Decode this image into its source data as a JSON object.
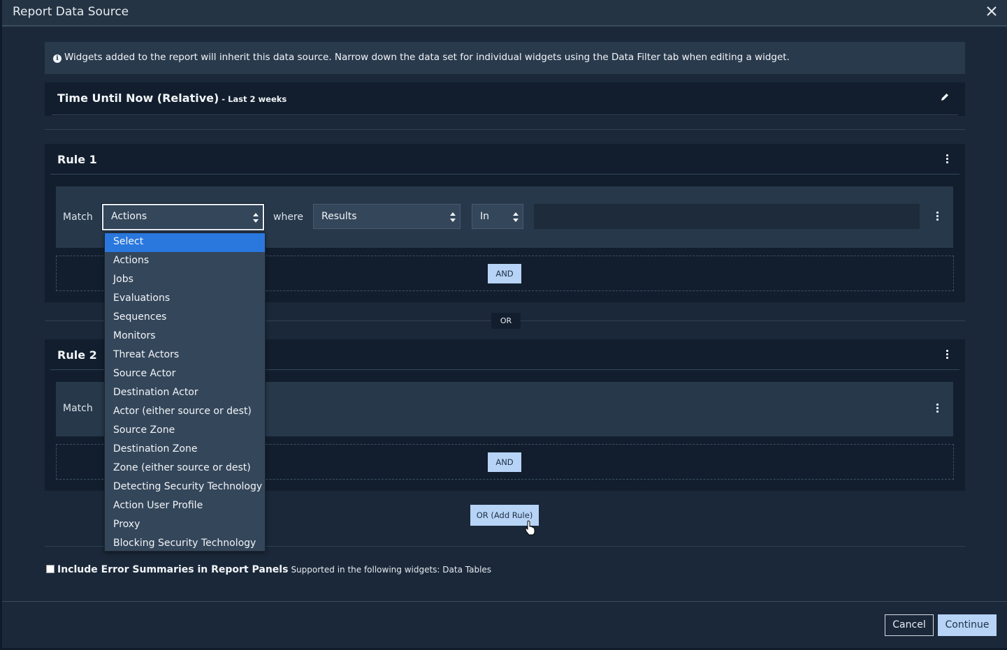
{
  "dialog": {
    "title": "Report Data Source",
    "close_icon": "close-icon"
  },
  "info_banner": {
    "icon": "info-circle-icon",
    "text": "Widgets added to the report will inherit this data source. Narrow down the data set for individual widgets using the Data Filter tab when editing a widget."
  },
  "time_range": {
    "label": "Time Until Now (Relative)",
    "detail": " - Last 2 weeks",
    "edit_icon": "pencil-icon"
  },
  "rules": [
    {
      "title": "Rule 1",
      "match_label": "Match",
      "match_value": "Actions",
      "where_label": "where",
      "field_value": "Results",
      "operator_value": "In",
      "value": "",
      "and_label": "AND"
    },
    {
      "title": "Rule 2",
      "match_label": "Match",
      "and_label": "AND"
    }
  ],
  "or_separator": "OR",
  "add_rule_label": "OR (Add Rule)",
  "match_dropdown": {
    "options": [
      "Select",
      "Actions",
      "Jobs",
      "Evaluations",
      "Sequences",
      "Monitors",
      "Threat Actors",
      "Source Actor",
      "Destination Actor",
      "Actor (either source or dest)",
      "Source Zone",
      "Destination Zone",
      "Zone (either source or dest)",
      "Detecting Security Technology",
      "Action User Profile",
      "Proxy",
      "Blocking Security Technology"
    ],
    "highlighted": "Select"
  },
  "error_summaries": {
    "checked": false,
    "label": "Include Error Summaries in Report Panels",
    "note": "Supported in the following widgets: Data Tables"
  },
  "footer": {
    "cancel_label": "Cancel",
    "continue_label": "Continue"
  },
  "colors": {
    "accent_button": "#b7d4f7",
    "highlight": "#2a78de",
    "panel": "#121e2d",
    "background": "#1b2839"
  }
}
